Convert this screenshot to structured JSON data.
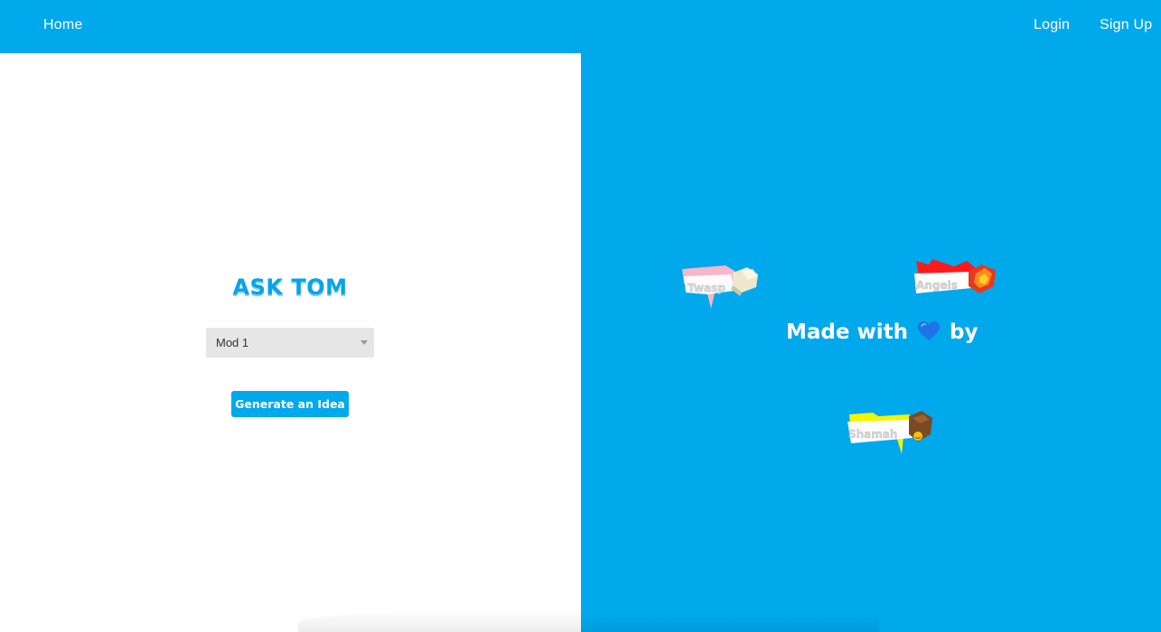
{
  "nav": {
    "home": "Home",
    "login": "Login",
    "signup": "Sign Up"
  },
  "main": {
    "title": "ASK TOM",
    "select": {
      "value": "Mod 1"
    },
    "button": "Generate an Idea"
  },
  "credits": {
    "made_with_prefix": "Made with",
    "made_with_suffix": "by",
    "heart_icon": "blue-heart-icon",
    "logos": [
      {
        "name": "Twasp",
        "icon": "pink-3d-logo"
      },
      {
        "name": "Angels",
        "icon": "red-3d-logo"
      },
      {
        "name": "Shamah",
        "icon": "yellow-3d-logo"
      }
    ]
  },
  "colors": {
    "accent": "#00a8ec",
    "background": "#ffffff",
    "select_bg": "#e6e6e6",
    "heart": "#1e73e8",
    "logo_pink": "#f8b6c8",
    "logo_red": "#ff1a1a",
    "logo_yellow": "#f5f500"
  }
}
